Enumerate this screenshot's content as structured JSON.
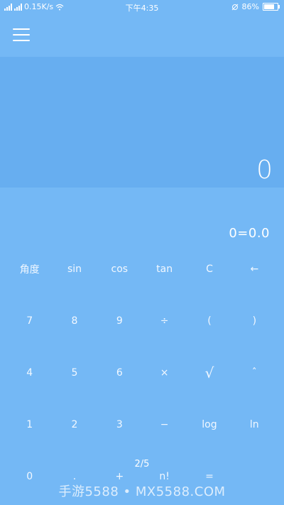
{
  "status_bar": {
    "signal1_label": "4G",
    "signal2_label": "4G",
    "net_speed": "0.15K/s",
    "time": "下午4:35",
    "battery_text": "86%",
    "battery_level": 0.86
  },
  "toolbar": {
    "menu_icon": "hamburger-menu-icon"
  },
  "display": {
    "value": "0"
  },
  "expression": "0=0.0",
  "keypad": {
    "rows": [
      [
        "角度",
        "sin",
        "cos",
        "tan",
        "C",
        "←"
      ],
      [
        "7",
        "8",
        "9",
        "÷",
        "(",
        ")"
      ],
      [
        "4",
        "5",
        "6",
        "×",
        "√",
        "ˆ"
      ],
      [
        "1",
        "2",
        "3",
        "−",
        "log",
        "ln"
      ],
      [
        "0",
        ".",
        "+",
        "n!",
        "=",
        ""
      ]
    ]
  },
  "pager": "2/5",
  "watermark": "手游5588 • MX5588.COM",
  "colors": {
    "background": "#74b8f5",
    "display_background": "#67aef0",
    "text": "#ffffff"
  }
}
